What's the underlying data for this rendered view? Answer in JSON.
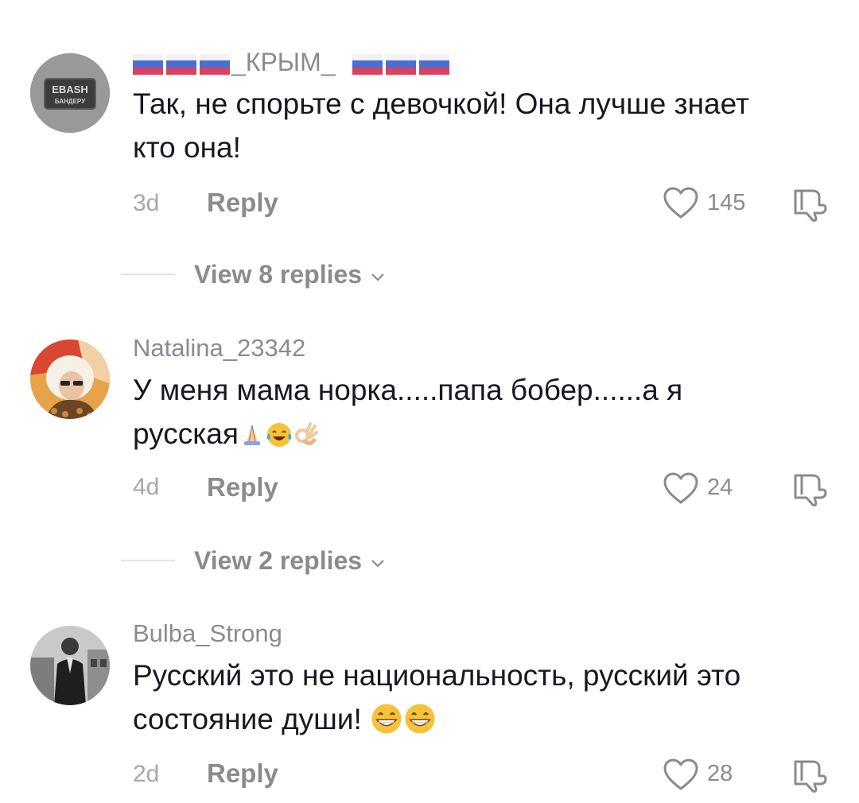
{
  "comments": [
    {
      "username": "_КРЫМ_",
      "text": "Так, не спорьте с девочкой! Она лучше знает кто она!",
      "time": "3d",
      "reply_label": "Reply",
      "likes": "145",
      "view_replies": "View 8 replies"
    },
    {
      "username": "Natalina_23342",
      "text": "У меня мама норка.....папа бобер......а я русская",
      "time": "4d",
      "reply_label": "Reply",
      "likes": "24",
      "view_replies": "View 2 replies"
    },
    {
      "username": "Bulba_Strong",
      "text": "Русский это не национальность, русский это состояние души!",
      "time": "2d",
      "reply_label": "Reply",
      "likes": "28"
    }
  ],
  "avatar1_text": {
    "line1": "EBASH",
    "line2": "БАНДЕРУ"
  },
  "colors": {
    "text": "#161823",
    "secondary": "#8a8b91",
    "muted": "#a6a7ab",
    "divider": "#e3e3e4"
  }
}
